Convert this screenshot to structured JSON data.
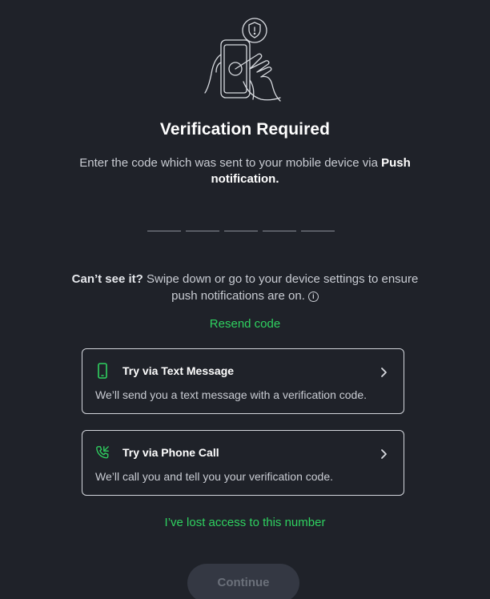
{
  "header": {
    "title": "Verification Required",
    "subtitle_prefix": "Enter the code which was sent to your mobile device via ",
    "subtitle_method": "Push notification."
  },
  "code_input": {
    "slots": 5
  },
  "help": {
    "bold": "Can’t see it?",
    "text": " Swipe down or go to your device settings to ensure push notifications are on.",
    "icon": "info-icon"
  },
  "resend_label": "Resend code",
  "options": [
    {
      "title": "Try via Text Message",
      "description": "We’ll send you a text message with a verification code.",
      "icon": "smartphone-icon"
    },
    {
      "title": "Try via Phone Call",
      "description": "We’ll call you and tell you your verification code.",
      "icon": "phone-incoming-icon"
    }
  ],
  "lost_access_label": "I’ve lost access to this number",
  "continue_label": "Continue",
  "colors": {
    "background": "#1f2229",
    "accent": "#2fd160",
    "text_primary": "#ffffff",
    "text_secondary": "#c9ccd3",
    "disabled_button": "#343843"
  }
}
